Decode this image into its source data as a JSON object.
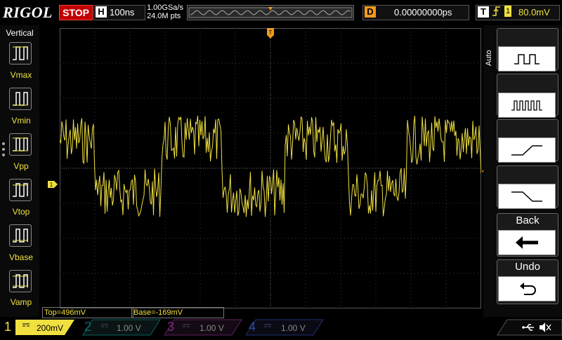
{
  "header": {
    "logo": "RIGOL",
    "run_state": "STOP",
    "horizontal_letter": "H",
    "timebase": "100ns",
    "sample_rate": "1.00GSa/s",
    "memory_depth": "24.0M pts",
    "delay_letter": "D",
    "delay_value": "0.00000000ps",
    "trigger_letter": "T",
    "trigger_source": "1",
    "trigger_level": "80.0mV"
  },
  "left_menu": {
    "title": "Vertical",
    "items": [
      {
        "label": "Vmax"
      },
      {
        "label": "Vmin"
      },
      {
        "label": "Vpp"
      },
      {
        "label": "Vtop"
      },
      {
        "label": "Vbase"
      },
      {
        "label": "Vamp"
      }
    ]
  },
  "right_menu": {
    "auto_label": "Auto",
    "back_label": "Back",
    "undo_label": "Undo"
  },
  "measurements": {
    "top": "Top=496mV",
    "base": "Base=-169mV"
  },
  "channels": [
    {
      "num": "1",
      "scale": "200mV",
      "color": "#f0e040"
    },
    {
      "num": "2",
      "scale": "1.00 V",
      "color": "#00c8c8"
    },
    {
      "num": "3",
      "scale": "1.00 V",
      "color": "#e040e0"
    },
    {
      "num": "4",
      "scale": "1.00 V",
      "color": "#3070ff"
    }
  ],
  "colors": {
    "ch1": "#f0e040",
    "trigger": "#f39a1e",
    "stop": "#c00000"
  },
  "markers": {
    "ch1_marker": "1",
    "trigger_marker": "T"
  }
}
